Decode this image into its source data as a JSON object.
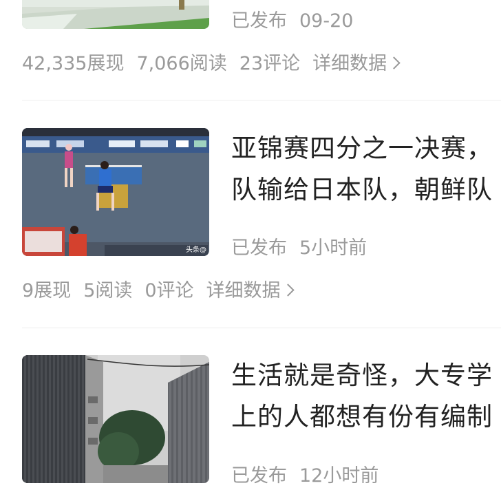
{
  "feed": {
    "items": [
      {
        "status": "已发布",
        "time": "09-20",
        "impressions": "42,335展现",
        "reads": "7,066阅读",
        "comments": "23评论",
        "detail_link": "详细数据"
      },
      {
        "title_line1": "亚锦赛四分之一决赛，",
        "title_line2": "队输给日本队，朝鲜队",
        "status": "已发布",
        "time": "5小时前",
        "impressions": "9展现",
        "reads": "5阅读",
        "comments": "0评论",
        "detail_link": "详细数据",
        "thumb_watermark": "头条@"
      },
      {
        "title_line1": "生活就是奇怪，大专学",
        "title_line2": "上的人都想有份有编制",
        "status": "已发布",
        "time": "12小时前"
      }
    ]
  }
}
